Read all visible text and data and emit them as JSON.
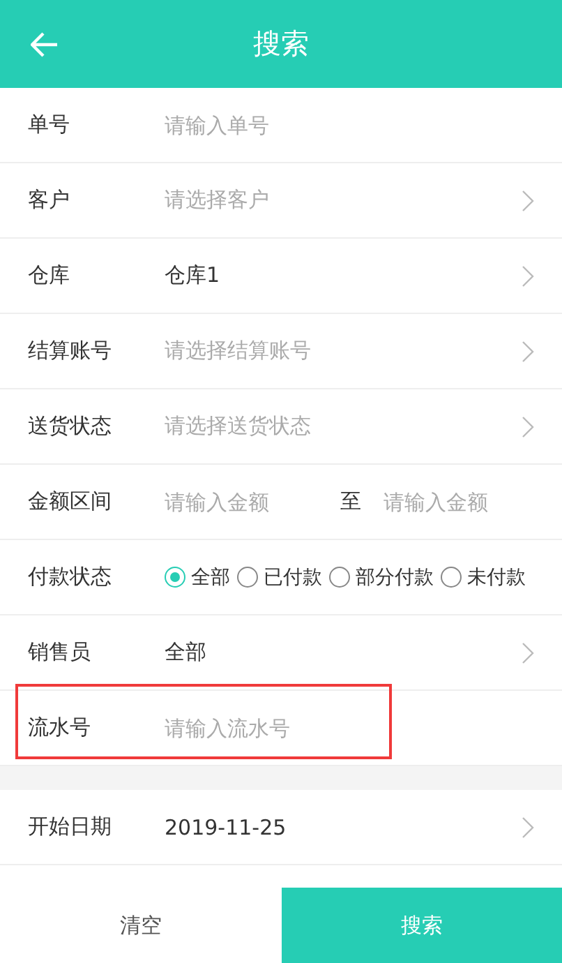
{
  "header": {
    "title": "搜索"
  },
  "rows": [
    {
      "kind": "input",
      "label": "单号",
      "placeholder": "请输入单号",
      "highlighted": false
    },
    {
      "kind": "select",
      "label": "客户",
      "placeholder": "请选择客户",
      "highlighted": false
    },
    {
      "kind": "select",
      "label": "仓库",
      "value": "仓库1",
      "highlighted": false
    },
    {
      "kind": "select",
      "label": "结算账号",
      "placeholder": "请选择结算账号",
      "highlighted": false
    },
    {
      "kind": "select",
      "label": "送货状态",
      "placeholder": "请选择送货状态",
      "highlighted": false
    },
    {
      "kind": "range",
      "label": "金额区间",
      "placeholder": "请输入金额",
      "separator": "至",
      "placeholder_2": "请输入金额",
      "highlighted": false
    },
    {
      "kind": "radio",
      "label": "付款状态",
      "options": [
        {
          "label": "全部",
          "selected": true
        },
        {
          "label": "已付款",
          "selected": false
        },
        {
          "label": "部分付款",
          "selected": false
        },
        {
          "label": "未付款",
          "selected": false
        }
      ],
      "highlighted": false
    },
    {
      "kind": "select",
      "label": "销售员",
      "value": "全部",
      "highlighted": false
    },
    {
      "kind": "input",
      "label": "流水号",
      "placeholder": "请输入流水号",
      "highlighted": true
    }
  ],
  "date_rows": [
    {
      "kind": "select",
      "label": "开始日期",
      "value": "2019-11-25",
      "highlighted": false
    }
  ],
  "footer": {
    "clear": "清空",
    "search": "搜索"
  }
}
